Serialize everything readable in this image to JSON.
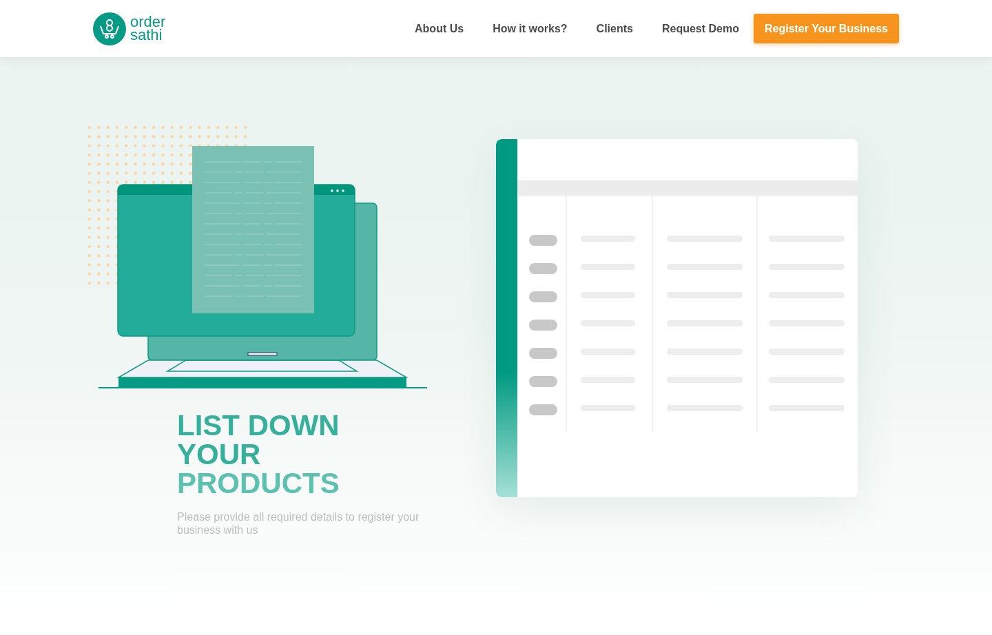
{
  "logo": {
    "line1": "order",
    "line2": "sathi"
  },
  "nav": [
    {
      "label": "About Us"
    },
    {
      "label": "How it works?"
    },
    {
      "label": "Clients"
    },
    {
      "label": "Request Demo"
    }
  ],
  "cta_button": "Register Your Business",
  "hero": {
    "heading_line1": "LIST DOWN YOUR",
    "heading_line2": "PRODUCTS",
    "subtitle": "Please provide all required details to register your business with us"
  }
}
